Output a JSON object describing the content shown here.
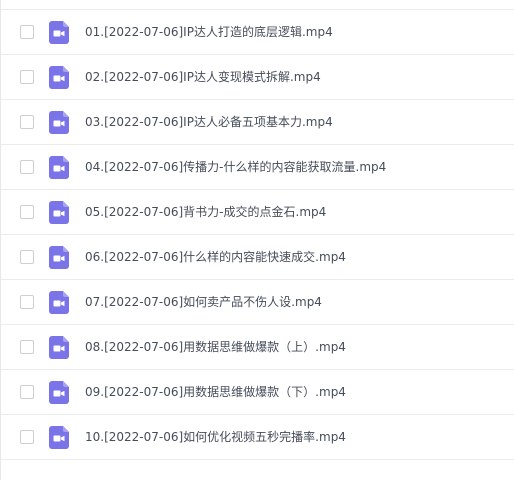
{
  "files": [
    {
      "name": "01.[2022-07-06]IP达人打造的底层逻辑.mp4",
      "icon": "video-file-icon"
    },
    {
      "name": "02.[2022-07-06]IP达人变现模式拆解.mp4",
      "icon": "video-file-icon"
    },
    {
      "name": "03.[2022-07-06]IP达人必备五项基本力.mp4",
      "icon": "video-file-icon"
    },
    {
      "name": "04.[2022-07-06]传播力-什么样的内容能获取流量.mp4",
      "icon": "video-file-icon"
    },
    {
      "name": "05.[2022-07-06]背书力-成交的点金石.mp4",
      "icon": "video-file-icon"
    },
    {
      "name": "06.[2022-07-06]什么样的内容能快速成交.mp4",
      "icon": "video-file-icon"
    },
    {
      "name": "07.[2022-07-06]如何卖产品不伤人设.mp4",
      "icon": "video-file-icon"
    },
    {
      "name": "08.[2022-07-06]用数据思维做爆款（上）.mp4",
      "icon": "video-file-icon"
    },
    {
      "name": "09.[2022-07-06]用数据思维做爆款（下）.mp4",
      "icon": "video-file-icon"
    },
    {
      "name": "10.[2022-07-06]如何优化视频五秒完播率.mp4",
      "icon": "video-file-icon"
    }
  ],
  "colors": {
    "icon_bg": "#7b73e8",
    "icon_fold": "#a9a3f2",
    "text": "#454d5a",
    "divider": "#ececec"
  }
}
